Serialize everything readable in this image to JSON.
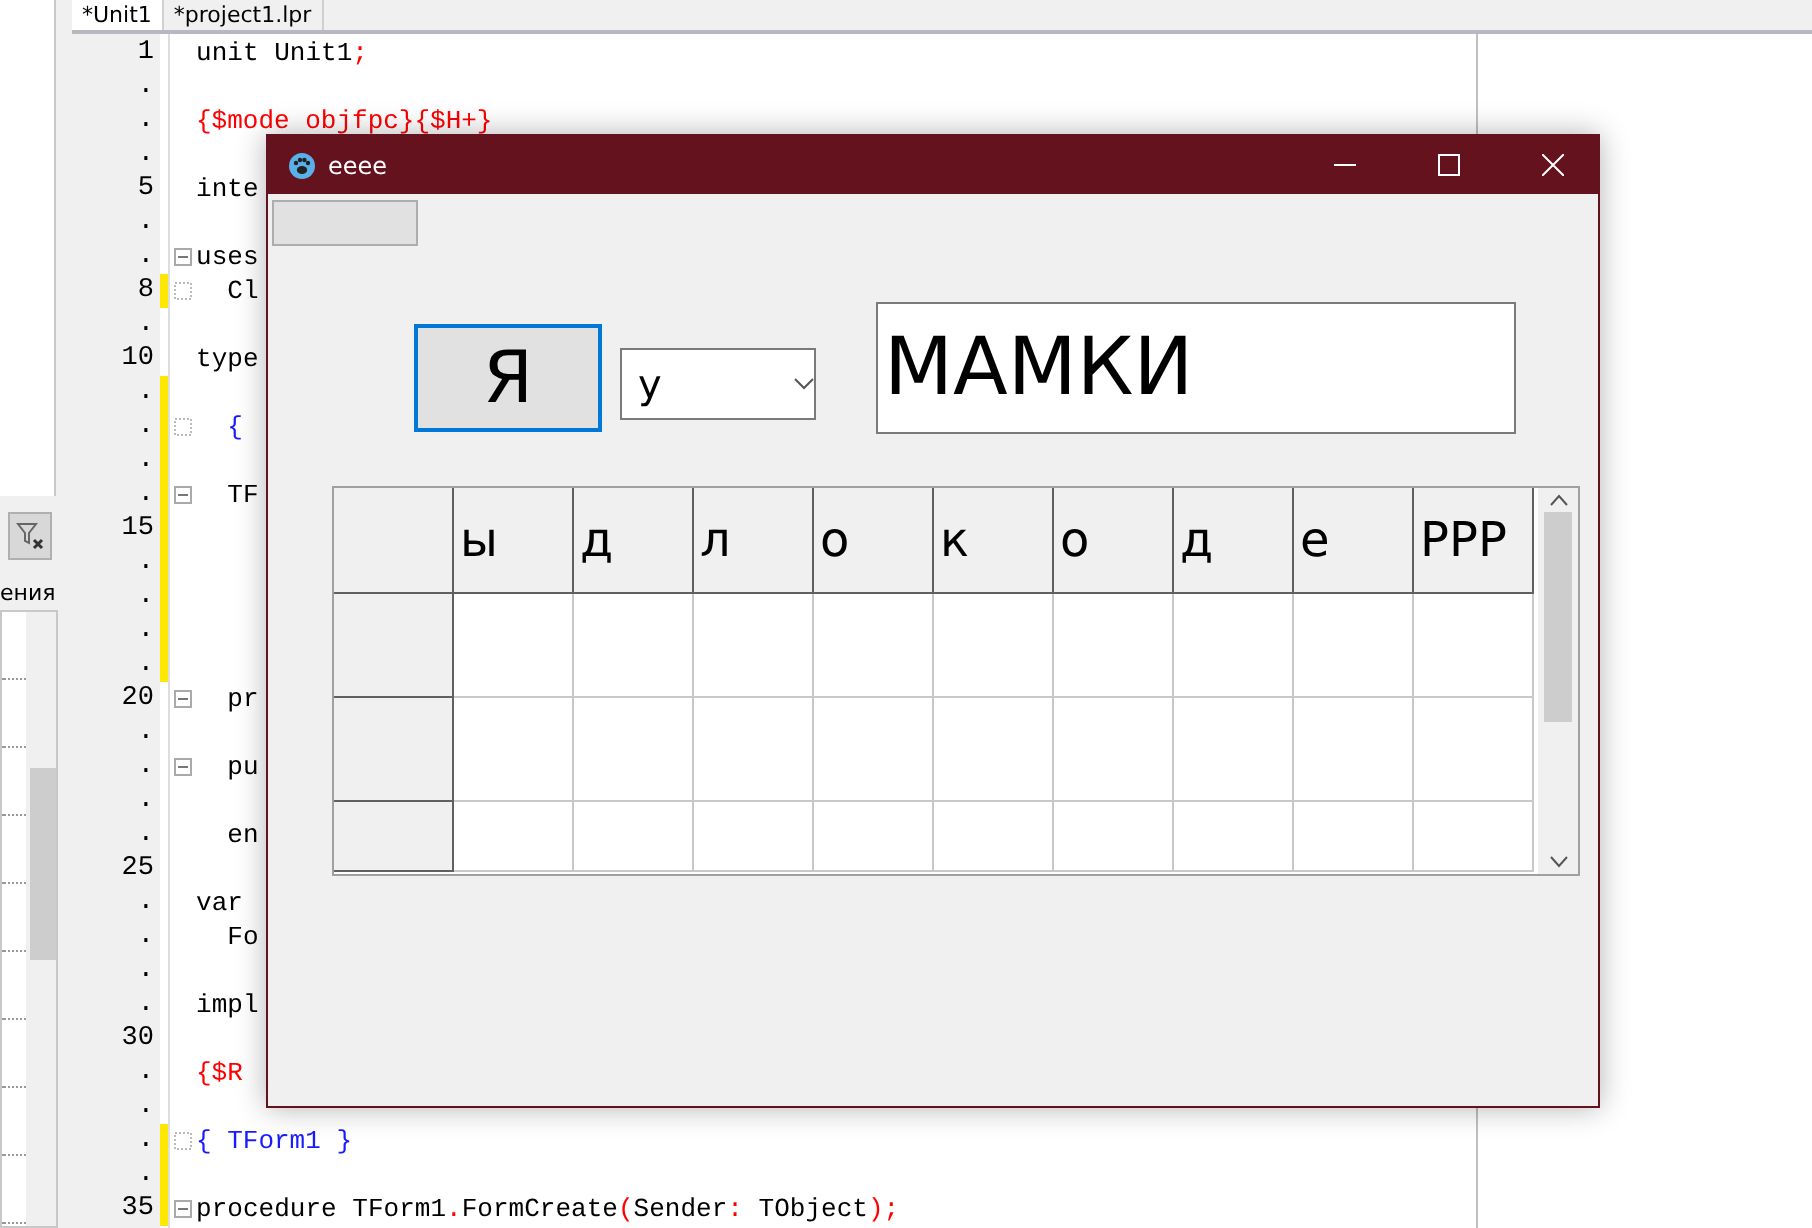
{
  "ide": {
    "tabs": [
      {
        "label": "*Unit1",
        "selected": true
      },
      {
        "label": "*project1.lpr",
        "selected": false
      }
    ],
    "side_panel": {
      "tab": "ения"
    },
    "editor": {
      "lines": [
        {
          "number": "1",
          "code": "unit Unit1;",
          "kind": "plain",
          "modified": false,
          "fold_box": false,
          "fold_dot": false
        },
        {
          "number": ".",
          "kind": "plain",
          "modified": false,
          "fold_box": false,
          "fold_dot": false
        },
        {
          "number": ".",
          "code": "{$mode objfpc}{$H+}",
          "kind": "directive",
          "modified": false,
          "fold_box": false,
          "fold_dot": false
        },
        {
          "number": ".",
          "kind": "plain",
          "modified": false,
          "fold_box": false,
          "fold_dot": false
        },
        {
          "number": "5",
          "code": "inte",
          "kind": "plain",
          "modified": false,
          "fold_box": false,
          "fold_dot": false
        },
        {
          "number": ".",
          "kind": "plain",
          "modified": false,
          "fold_box": false,
          "fold_dot": false
        },
        {
          "number": ".",
          "code": "uses",
          "kind": "plain",
          "modified": false,
          "fold_box": true,
          "fold_dot": false
        },
        {
          "number": "8",
          "code": "  Cl",
          "kind": "plain",
          "modified": true,
          "fold_box": false,
          "fold_dot": true
        },
        {
          "number": ".",
          "kind": "plain",
          "modified": false,
          "fold_box": false,
          "fold_dot": false
        },
        {
          "number": "10",
          "code": "type",
          "kind": "plain",
          "modified": false,
          "fold_box": false,
          "fold_dot": false
        },
        {
          "number": ".",
          "kind": "plain",
          "modified": true,
          "fold_box": false,
          "fold_dot": false
        },
        {
          "number": ".",
          "code": "  {",
          "kind": "comment",
          "modified": true,
          "fold_box": false,
          "fold_dot": true
        },
        {
          "number": ".",
          "kind": "plain",
          "modified": true,
          "fold_box": false,
          "fold_dot": false
        },
        {
          "number": ".",
          "code": "  TF",
          "kind": "plain",
          "modified": true,
          "fold_box": true,
          "fold_dot": false
        },
        {
          "number": "15",
          "kind": "plain",
          "modified": true,
          "fold_box": false,
          "fold_dot": false
        },
        {
          "number": ".",
          "kind": "plain",
          "modified": true,
          "fold_box": false,
          "fold_dot": false
        },
        {
          "number": ".",
          "kind": "plain",
          "modified": true,
          "fold_box": false,
          "fold_dot": false
        },
        {
          "number": ".",
          "kind": "plain",
          "modified": true,
          "fold_box": false,
          "fold_dot": false
        },
        {
          "number": ".",
          "kind": "plain",
          "modified": true,
          "fold_box": false,
          "fold_dot": false
        },
        {
          "number": "20",
          "code": "  pr",
          "kind": "plain",
          "modified": false,
          "fold_box": true,
          "fold_dot": false
        },
        {
          "number": ".",
          "kind": "plain",
          "modified": false,
          "fold_box": false,
          "fold_dot": false
        },
        {
          "number": ".",
          "code": "  pu",
          "kind": "plain",
          "modified": false,
          "fold_box": true,
          "fold_dot": false
        },
        {
          "number": ".",
          "kind": "plain",
          "modified": false,
          "fold_box": false,
          "fold_dot": false
        },
        {
          "number": ".",
          "code": "  en",
          "kind": "plain",
          "modified": false,
          "fold_box": false,
          "fold_dot": false
        },
        {
          "number": "25",
          "kind": "plain",
          "modified": false,
          "fold_box": false,
          "fold_dot": false
        },
        {
          "number": ".",
          "code": "var",
          "kind": "plain",
          "modified": false,
          "fold_box": false,
          "fold_dot": false
        },
        {
          "number": ".",
          "code": "  Fo",
          "kind": "plain",
          "modified": false,
          "fold_box": false,
          "fold_dot": false
        },
        {
          "number": ".",
          "kind": "plain",
          "modified": false,
          "fold_box": false,
          "fold_dot": false
        },
        {
          "number": ".",
          "code": "impl",
          "kind": "plain",
          "modified": false,
          "fold_box": false,
          "fold_dot": false
        },
        {
          "number": "30",
          "kind": "plain",
          "modified": false,
          "fold_box": false,
          "fold_dot": false
        },
        {
          "number": ".",
          "code": "{$R",
          "kind": "directive",
          "modified": false,
          "fold_box": false,
          "fold_dot": false
        },
        {
          "number": ".",
          "kind": "plain",
          "modified": false,
          "fold_box": false,
          "fold_dot": false
        },
        {
          "number": ".",
          "code": "{ TForm1 }",
          "kind": "comment",
          "modified": true,
          "fold_box": false,
          "fold_dot": true
        },
        {
          "number": ".",
          "kind": "plain",
          "modified": true,
          "fold_box": false,
          "fold_dot": false
        },
        {
          "number": "35",
          "code": "procedure TForm1.FormCreate(Sender: TObject);",
          "kind": "plain",
          "modified": true,
          "fold_box": true,
          "fold_dot": false
        }
      ]
    }
  },
  "form": {
    "title": "eeee",
    "button": {
      "label": "Я",
      "focused": true
    },
    "combo": {
      "value": "у"
    },
    "edit": {
      "value": "МАМКИ"
    },
    "grid": {
      "columns": [
        "ы",
        "д",
        "л",
        "о",
        "к",
        "о",
        "д",
        "е",
        "РРР"
      ]
    }
  }
}
